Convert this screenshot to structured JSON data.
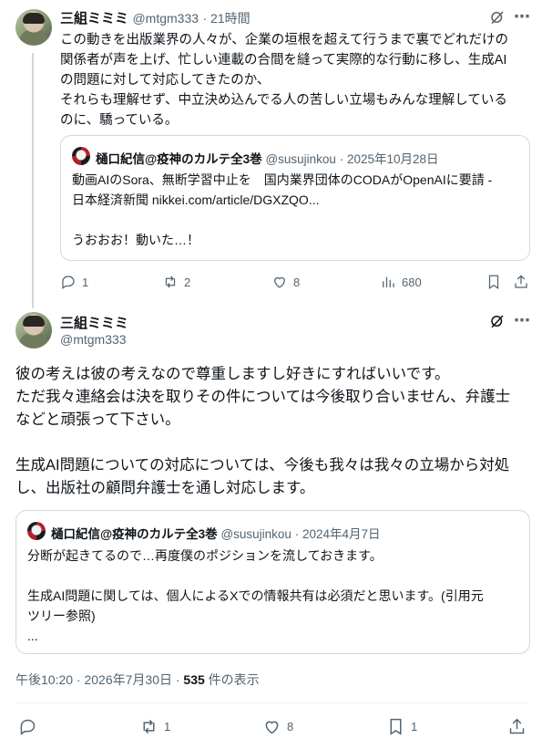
{
  "tweet1": {
    "name": "三組ミミミ",
    "handle": "@mtgm333",
    "time": "· 21時間",
    "body_lines": [
      "この動きを出版業界の人々が、企業の垣根を超えて行うまで裏でどれだけの",
      "関係者が声を上げ、忙しい連載の合間を縫って実際的な行動に移し、生成AI",
      "の問題に対して対応してきたのか、",
      "それらも理解せず、中立決め込んでる人の苦しい立場もみんな理解している",
      "のに、驕っている。"
    ],
    "quote": {
      "name": "樋口紀信@疫神のカルテ全3巻",
      "handle": "@susujinkou",
      "date": "· 2025年10月28日",
      "lines": [
        "動画AIのSora、無断学習中止を　国内業界団体のCODAがOpenAIに要請 -",
        "日本経済新聞 nikkei.com/article/DGXZQO...",
        "",
        "うおおお！動いた…！"
      ]
    },
    "actions": {
      "replies": "1",
      "reposts": "2",
      "likes": "8",
      "views": "680"
    }
  },
  "tweet2": {
    "name": "三組ミミミ",
    "handle": "@mtgm333",
    "body_lines": [
      "彼の考えは彼の考えなので尊重しますし好きにすればいいです。",
      "ただ我々連絡会は決を取りその件については今後取り合いません、弁護士",
      "などと頑張って下さい。",
      "",
      "生成AI問題についての対応については、今後も我々は我々の立場から対処",
      "し、出版社の顧問弁護士を通し対応します。"
    ],
    "quote": {
      "name": "樋口紀信@疫神のカルテ全3巻",
      "handle": "@susujinkou",
      "date": "· 2024年4月7日",
      "lines": [
        "分断が起きてるので…再度僕のポジションを流しておきます。",
        "",
        "生成AI問題に関しては、個人によるXでの情報共有は必須だと思います。(引用元",
        "ツリー参照)",
        "..."
      ]
    },
    "meta": {
      "datetime": "午後10:20 · 2026年7月30日 · ",
      "views_count": "535",
      "views_label": " 件の表示"
    },
    "actions": {
      "reposts": "1",
      "likes": "8",
      "bookmarks": "1"
    }
  },
  "icons": [
    "grok-icon",
    "more-icon",
    "reply-icon",
    "repost-icon",
    "like-icon",
    "views-icon",
    "bookmark-icon",
    "share-icon"
  ],
  "colors": {
    "text": "#0f1419",
    "muted": "#536471",
    "border": "#cfd9de"
  }
}
